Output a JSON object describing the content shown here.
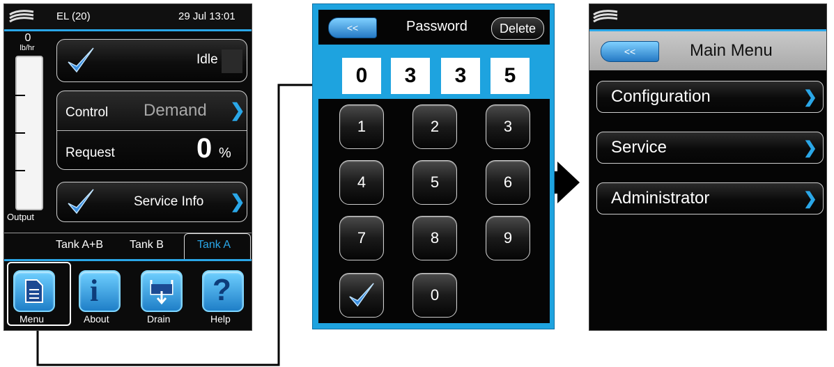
{
  "screen1": {
    "topbar": {
      "title": "EL (20)",
      "datetime": "29 Jul 13:01"
    },
    "gauge": {
      "value": "0",
      "unit": "lb/hr",
      "label": "Output",
      "level": 0
    },
    "status": {
      "text": "Idle"
    },
    "control": {
      "label": "Control",
      "value": "Demand"
    },
    "request": {
      "label": "Request",
      "value": "0",
      "unit": "%"
    },
    "service_info": {
      "label": "Service Info"
    },
    "tabs": [
      "Tank A+B",
      "Tank B",
      "Tank A"
    ],
    "bottom_buttons": [
      {
        "label": "Menu",
        "icon": "document-icon"
      },
      {
        "label": "About",
        "icon": "info-icon"
      },
      {
        "label": "Drain",
        "icon": "drain-icon"
      },
      {
        "label": "Help",
        "icon": "help-icon"
      }
    ]
  },
  "screen2": {
    "back_label": "<<",
    "title": "Password",
    "delete_label": "Delete",
    "pin": [
      "0",
      "3",
      "3",
      "5"
    ],
    "keys": [
      "1",
      "2",
      "3",
      "4",
      "5",
      "6",
      "7",
      "8",
      "9",
      "0"
    ]
  },
  "screen3": {
    "back_label": "<<",
    "title": "Main Menu",
    "items": [
      "Configuration",
      "Service",
      "Administrator"
    ]
  },
  "colors": {
    "accent": "#2aa7e8",
    "panel_blue": "#1ea3df",
    "header_gray": "#b7b7b7"
  }
}
